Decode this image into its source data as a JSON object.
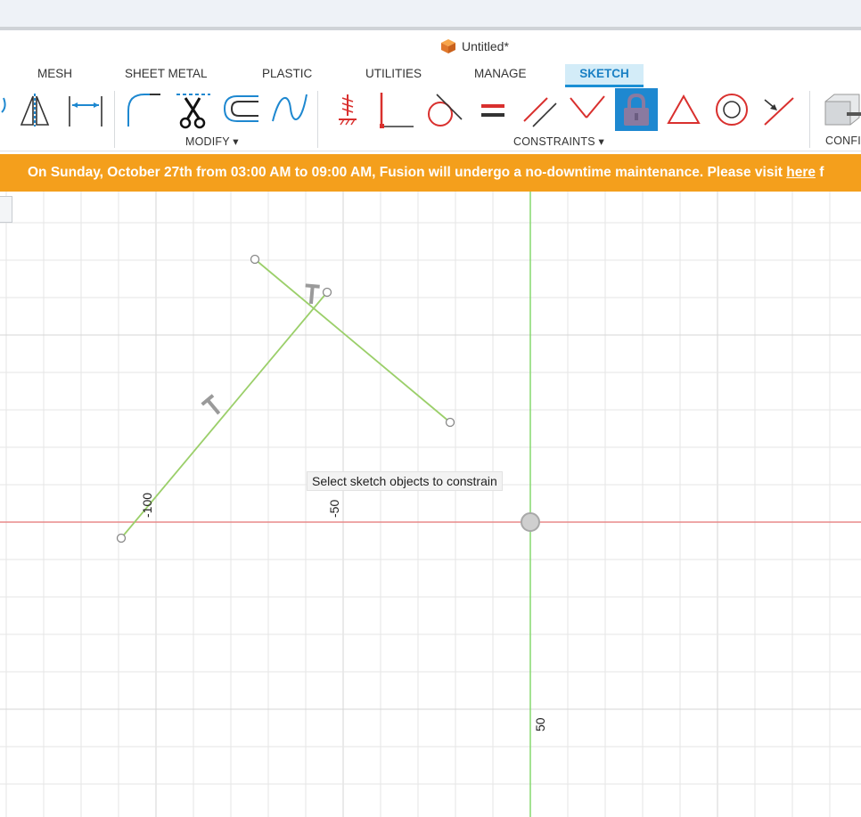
{
  "window": {
    "title": "Untitled*"
  },
  "tabs": [
    {
      "label": "MESH",
      "active": false
    },
    {
      "label": "SHEET METAL",
      "active": false
    },
    {
      "label": "PLASTIC",
      "active": false
    },
    {
      "label": "UTILITIES",
      "active": false
    },
    {
      "label": "MANAGE",
      "active": false
    },
    {
      "label": "SKETCH",
      "active": true
    }
  ],
  "toolbar": {
    "modify_label": "MODIFY ▾",
    "constraints_label": "CONSTRAINTS ▾",
    "configure_label": "CONFI",
    "modify_tools": [
      "fillet-icon",
      "trim-icon",
      "offset-icon",
      "spline-icon"
    ],
    "constraint_tools": [
      "fix-icon",
      "perpendicular-icon",
      "tangent-icon",
      "equal-icon",
      "parallel-icon",
      "collinear-icon",
      "lock-icon",
      "triangle-icon",
      "concentric-icon",
      "midpoint-icon"
    ],
    "selected_tool": "lock-icon"
  },
  "banner": {
    "text": "On Sunday, October 27th from 03:00 AM to 09:00 AM, Fusion will undergo a no-downtime maintenance. Please visit ",
    "link": "here",
    "tail": " f",
    "color": "#f49f1c"
  },
  "canvas": {
    "tooltip": "Select sketch objects to constrain",
    "axis_labels": {
      "x_neg100": "-100",
      "x_neg50": "-50",
      "y_50": "50"
    },
    "colors": {
      "sketch_line": "#9bcf6a",
      "x_axis": "#e67a7a",
      "y_axis": "#7fd46b",
      "grid": "#e6e6e6"
    }
  }
}
